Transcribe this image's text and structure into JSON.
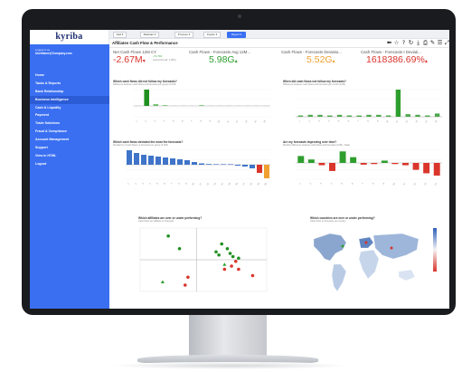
{
  "colors": {
    "accent": "#3a6ff2",
    "positive": "#2e9e2e",
    "negative": "#d9352b",
    "warning": "#f0a030",
    "green_dark": "#1f8f1f",
    "bar_blue": "#3f74c9"
  },
  "sidebar": {
    "logo": "kyriba",
    "logged_in_label": "Logged in as",
    "user": "UserName@Company.com",
    "items": [
      {
        "label": "Home"
      },
      {
        "label": "Tasks & Reports"
      },
      {
        "label": "Bank Relationship"
      },
      {
        "label": "Business Intelligence"
      },
      {
        "label": "Cash & Liquidity"
      },
      {
        "label": "Payment"
      },
      {
        "label": "Trade Solutions"
      },
      {
        "label": "Fraud & Compliance"
      },
      {
        "label": "Account Management"
      },
      {
        "label": "Support"
      },
      {
        "label": "View in HTML"
      },
      {
        "label": "Logout"
      }
    ],
    "active_index": 3
  },
  "topbar": {
    "menus": [
      {
        "label": "Add ▾"
      },
      {
        "label": "Maintain ▾"
      },
      {
        "label": "Process ▾"
      },
      {
        "label": "Inquire ▾"
      },
      {
        "label": "Report ▾"
      }
    ]
  },
  "page": {
    "title": "Affiliates Cash Flow & Performance",
    "toolbar_icons": [
      "back-icon",
      "star-icon",
      "help-icon",
      "refresh-icon",
      "download-icon",
      "print-icon",
      "edit-icon",
      "list-icon",
      "expand-icon"
    ]
  },
  "kpis": [
    {
      "label": "Net Cash Flows 12M CY",
      "value": "-2.67M",
      "arrow": "▾",
      "sub1": "-71,716",
      "sub2": "(Last Period: 1.8%)",
      "color": "#d9352b"
    },
    {
      "label": "Cash Flows - Forecasts Avg 12M...",
      "value": "5.98G",
      "arrow": "▴",
      "color": "#2e9e2e"
    },
    {
      "label": "Cash Flows - Forecasts Deviatio...",
      "value": "5.52G",
      "arrow": "▴",
      "color": "#f0a030"
    },
    {
      "label": "Cash Flows - Forecasts t Deviati...",
      "value": "1618386.69%",
      "arrow": "▴",
      "color": "#d9352b"
    }
  ],
  "panels": [
    {
      "title": "Which cash flows did not follow my forecasts?",
      "subtitle": "Difference between cash flows and forecasts per group of CFE"
    },
    {
      "title": "When did cash flows not follow my forecasts?",
      "subtitle": "Difference between cash flows and forecasts per month (12M)"
    },
    {
      "title": "Which cash flows deviated the most the forecasts?",
      "subtitle": "Deviations of cash flows vs forecasts per group of CFE"
    },
    {
      "title": "Are my forecasts improving over time?",
      "subtitle": "Monthly difference between cash flows and forecasts (12M) - Ratio"
    },
    {
      "title": "Which affiliates are over or under performing?",
      "subtitle": "Cash flows per affiliate vs forecasts"
    },
    {
      "title": "Which countries are over or under performing?",
      "subtitle": "Cash flows vs forecasts per country"
    }
  ],
  "chart_data": [
    {
      "type": "bar",
      "categories": [
        "1",
        "2",
        "3",
        "4",
        "5",
        "6",
        "7",
        "8",
        "9",
        "10",
        "11",
        "12",
        "13",
        "14",
        "15"
      ],
      "values": [
        0,
        38,
        4,
        1,
        0,
        0,
        0,
        1,
        0,
        0,
        0,
        0,
        0,
        0,
        0
      ]
    },
    {
      "type": "bar",
      "categories": [
        "1",
        "2",
        "3",
        "4",
        "5",
        "6",
        "7",
        "8",
        "9",
        "10",
        "11",
        "12",
        "13",
        "14",
        "15"
      ],
      "values": [
        2,
        3,
        3,
        2,
        3,
        2,
        2,
        3,
        3,
        2,
        42,
        4,
        3,
        2,
        5
      ]
    },
    {
      "type": "bar",
      "categories": [
        "1",
        "2",
        "3",
        "4",
        "5",
        "6",
        "7",
        "8",
        "9",
        "10",
        "11",
        "12",
        "13",
        "14",
        "15",
        "16",
        "17",
        "18",
        "19",
        "20"
      ],
      "values": [
        32,
        26,
        22,
        20,
        18,
        16,
        14,
        12,
        10,
        6,
        3,
        1,
        0,
        0,
        0,
        -2,
        -4,
        -8,
        -18,
        -30
      ]
    },
    {
      "type": "bar",
      "categories": [
        "1",
        "2",
        "3",
        "4",
        "5",
        "6",
        "7",
        "8",
        "9",
        "10",
        "11",
        "12",
        "13",
        "14"
      ],
      "values": [
        12,
        6,
        -4,
        -14,
        20,
        10,
        -3,
        -2,
        4,
        -2,
        -4,
        -12,
        -18,
        -22
      ]
    },
    {
      "type": "scatter",
      "points": [
        [
          -20,
          30
        ],
        [
          -12,
          14
        ],
        [
          18,
          20
        ],
        [
          22,
          14
        ],
        [
          24,
          8
        ],
        [
          26,
          4
        ],
        [
          28,
          -2
        ],
        [
          30,
          2
        ],
        [
          25,
          -8
        ],
        [
          20,
          -6
        ],
        [
          -6,
          -22
        ],
        [
          14,
          10
        ],
        [
          20,
          -12
        ],
        [
          16,
          6
        ],
        [
          40,
          -20
        ],
        [
          -24,
          -28
        ],
        [
          30,
          -12
        ],
        [
          -8,
          -32
        ]
      ]
    }
  ]
}
